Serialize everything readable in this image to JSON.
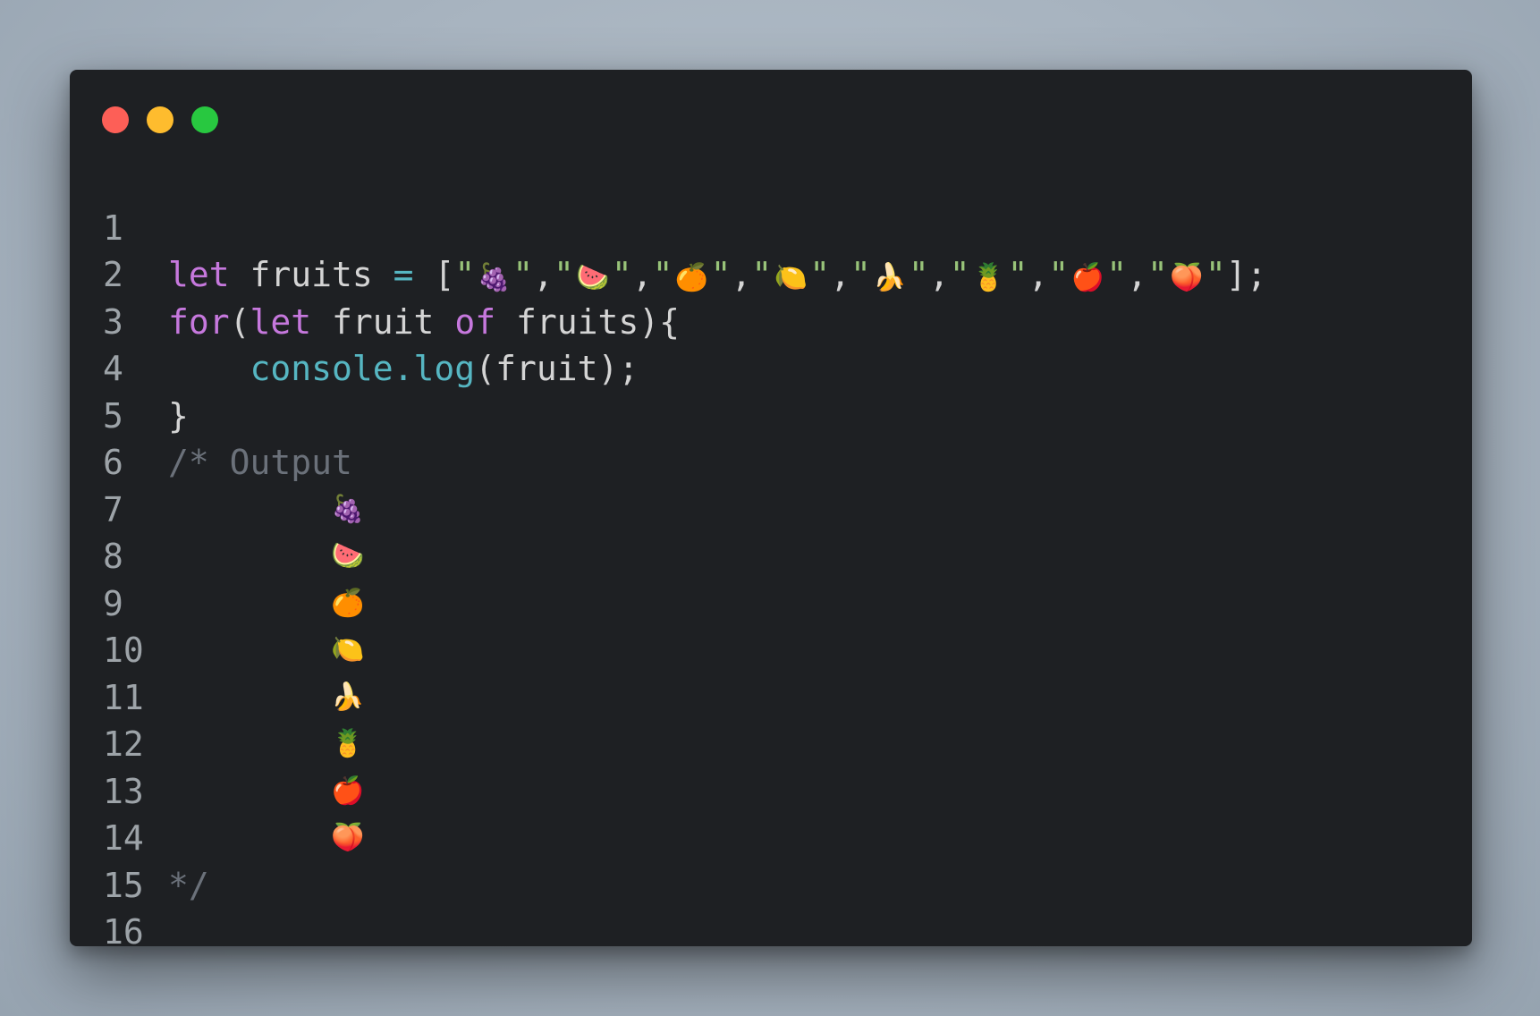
{
  "window": {
    "traffic_lights": [
      "#fd5f57",
      "#febc2e",
      "#28c840"
    ]
  },
  "line_numbers": [
    "1",
    "2",
    "3",
    "4",
    "5",
    "6",
    "7",
    "8",
    "9",
    "10",
    "11",
    "12",
    "13",
    "14",
    "15",
    "16"
  ],
  "code": {
    "l1": {
      "kw_let": "let",
      "var": " fruits ",
      "eq": "=",
      "open": " [",
      "items": [
        "🍇",
        "🍉",
        "🍊",
        "🍋",
        "🍌",
        "🍍",
        "🍎",
        "🍑"
      ],
      "close": "];"
    },
    "l2": {
      "kw_for": "for",
      "paren": "(",
      "kw_let": "let",
      "mid": " fruit ",
      "kw_of": "of",
      "end": " fruits){"
    },
    "l3": {
      "indent": "    ",
      "call": "console.log",
      "args": "(fruit);"
    },
    "l4": "}",
    "l5": "/* Output",
    "output": [
      "🍇",
      "🍉",
      "🍊",
      "🍋",
      "🍌",
      "🍍",
      "🍎",
      "🍑"
    ],
    "l14": "*/"
  },
  "colors": {
    "background": "#1e2023",
    "keyword": "#c678dd",
    "function": "#56b6c2",
    "string": "#98c379",
    "comment": "#6b717a",
    "line_number": "#9da3a8"
  }
}
